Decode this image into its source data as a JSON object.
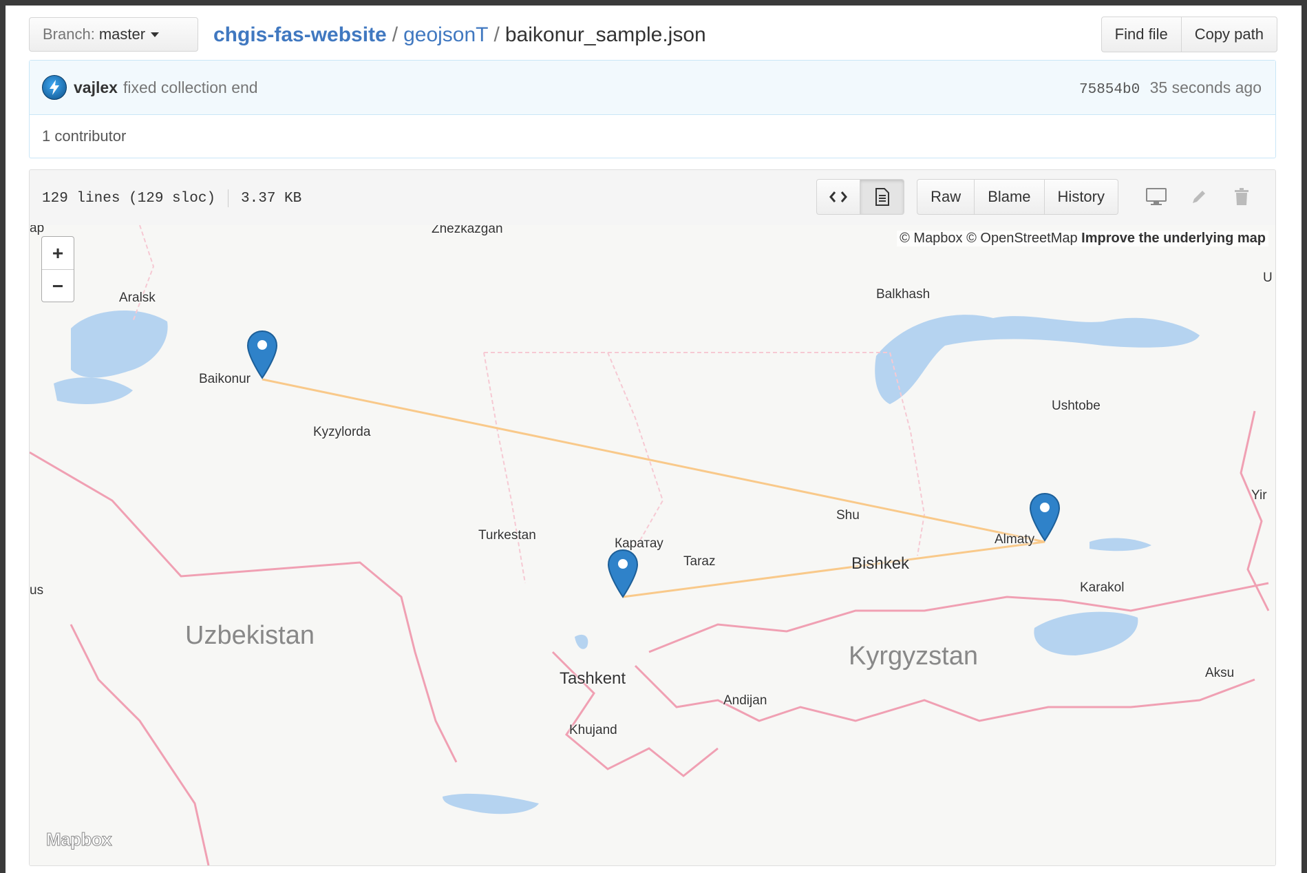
{
  "header": {
    "branch_prefix": "Branch:",
    "branch_name": "master",
    "breadcrumb": {
      "repo": "chgis-fas-website",
      "sep1": "/",
      "folder": "geojsonT",
      "sep2": "/",
      "file": "baikonur_sample.json"
    },
    "find_file_label": "Find file",
    "copy_path_label": "Copy path"
  },
  "commit": {
    "author": "vajlex",
    "message": "fixed collection end",
    "sha": "75854b0",
    "time": "35 seconds ago",
    "contributors": "1 contributor"
  },
  "file": {
    "lines": "129 lines (129 sloc)",
    "size": "3.37 KB",
    "raw_label": "Raw",
    "blame_label": "Blame",
    "history_label": "History"
  },
  "map": {
    "attribution_mapbox": "© Mapbox",
    "attribution_osm": "© OpenStreetMap",
    "attribution_improve": "Improve the underlying map",
    "zoom_in": "+",
    "zoom_out": "−",
    "logo": "Mapbox",
    "route_color": "#f9c98a",
    "marker_color": "#2f82c9",
    "cities": {
      "zhezkazgan": "Zhezkazgan",
      "aralsk": "Aralsk",
      "balkhash": "Balkhash",
      "baikonur": "Baikonur",
      "kyzylorda": "Kyzylorda",
      "ushtobe": "Ushtobe",
      "shu": "Shu",
      "almaty": "Almaty",
      "turkestan": "Turkestan",
      "karatau": "Каратау",
      "taraz": "Taraz",
      "bishkek": "Bishkek",
      "karakol": "Karakol",
      "tashkent": "Tashkent",
      "andijan": "Andijan",
      "aksu": "Aksu",
      "khujand": "Khujand",
      "edge_ap": "ap",
      "edge_us": "us",
      "edge_u": "U",
      "edge_yi": "Yir"
    },
    "countries": {
      "uzbekistan": "Uzbekistan",
      "kyrgyzstan": "Kyrgyzstan"
    }
  }
}
